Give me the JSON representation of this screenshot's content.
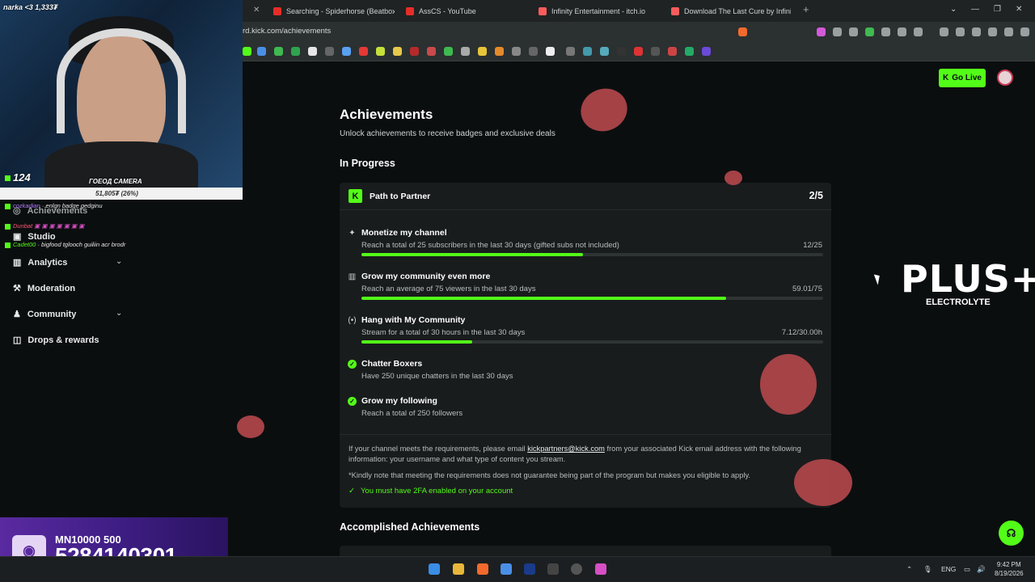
{
  "browser": {
    "tabs": [
      {
        "label": "Searching - Spiderhorse (Beatbox Re",
        "color": "#e52d27"
      },
      {
        "label": "AssCS - YouTube",
        "color": "#e52d27"
      },
      {
        "label": "Infinity Entertainment - itch.io",
        "color": "#fa5c5c"
      },
      {
        "label": "Download The Last Cure by Infinity E",
        "color": "#fa5c5c"
      }
    ],
    "url": "rd.kick.com/achievements"
  },
  "header": {
    "go_live": "Go Live"
  },
  "sidebar": {
    "items": [
      {
        "label": "Achievements"
      },
      {
        "label": "Studio"
      },
      {
        "label": "Analytics"
      },
      {
        "label": "Moderation"
      },
      {
        "label": "Community"
      },
      {
        "label": "Drops & rewards"
      }
    ]
  },
  "main": {
    "title": "Achievements",
    "subtitle": "Unlock achievements to receive badges and exclusive deals",
    "in_progress_heading": "In Progress",
    "accomplished_heading": "Accomplished Achievements",
    "card": {
      "title": "Path to Partner",
      "count": "2/5",
      "achievements": [
        {
          "title": "Monetize my channel",
          "desc": "Reach a total of 25 subscribers in the last 30 days (gifted subs not included)",
          "value": "12/25",
          "progress": 0.48
        },
        {
          "title": "Grow my community even more",
          "desc": "Reach an average of 75 viewers in the last 30 days",
          "value": "59.01/75",
          "progress": 0.79
        },
        {
          "title": "Hang with My Community",
          "desc": "Stream for a total of 30 hours in the last 30 days",
          "value": "7.12/30.00h",
          "progress": 0.24
        },
        {
          "title": "Chatter Boxers",
          "desc": "Have 250 unique chatters in the last 30 days"
        },
        {
          "title": "Grow my following",
          "desc": "Reach a total of 250 followers"
        }
      ],
      "note_prefix": "If your channel meets the requirements, please email ",
      "note_email": "kickpartners@kick.com",
      "note_suffix": " from your associated Kick email address with the following information: your username and what type of content you stream.",
      "note2": "*Kindly note that meeting the requirements does not guarantee being part of the program but makes you eligible to apply.",
      "twofa": "You must have 2FA enabled on your account"
    }
  },
  "overlay": {
    "streamer": "narka <3",
    "stream_count": "1,333₮",
    "k_count": "124",
    "cam_label": "ГОЕОД CAMERA",
    "bar_value": "51,805₮ (26%)",
    "chat": [
      {
        "user": "cozkadian",
        "msg": "enlgn badge gedginu",
        "color": "#b07cff"
      },
      {
        "user": "Dunbat",
        "msg": "",
        "color": "#ff5577"
      },
      {
        "user": "Cadet00",
        "msg": "bigfood tglooch guiliin acr brodr",
        "color": "#53fc18"
      }
    ],
    "brand_big": "PLUS+",
    "brand_small": "ELECTROLYTE",
    "sub_top": "MN10000 500",
    "sub_number": "5284140301"
  },
  "taskbar": {
    "lang": "ENG",
    "time": "9:42 PM",
    "date": "8/19/2026"
  }
}
